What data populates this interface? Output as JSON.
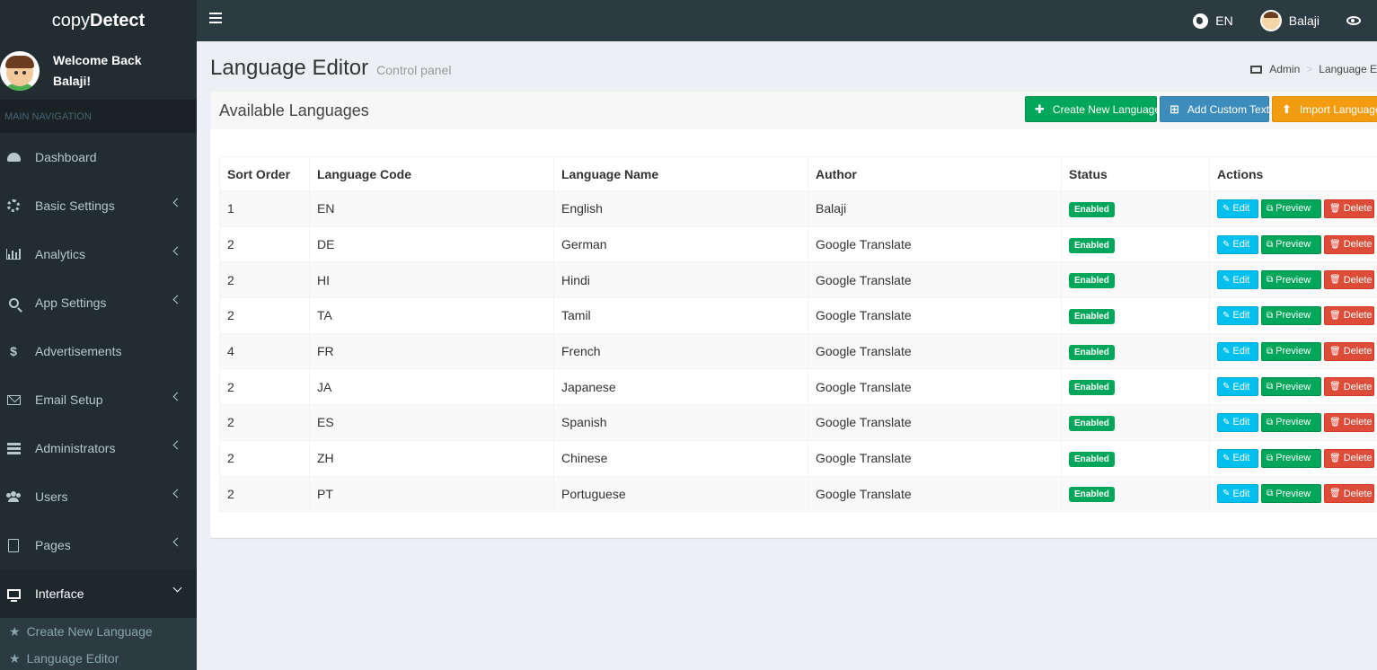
{
  "brand": {
    "light": "copy",
    "bold": "Detect"
  },
  "topbar": {
    "language": "EN",
    "username": "Balaji"
  },
  "user_panel": {
    "line1": "Welcome Back",
    "line2": "Balaji!"
  },
  "sidebar": {
    "header": "MAIN NAVIGATION",
    "items": [
      {
        "label": "Dashboard",
        "icon": "dashboard-icon"
      },
      {
        "label": "Basic Settings",
        "icon": "cogs-icon"
      },
      {
        "label": "Analytics",
        "icon": "bar-chart-icon"
      },
      {
        "label": "App Settings",
        "icon": "search-icon"
      },
      {
        "label": "Advertisements",
        "icon": "dollar-icon"
      },
      {
        "label": "Email Setup",
        "icon": "envelope-icon"
      },
      {
        "label": "Administrators",
        "icon": "list-icon"
      },
      {
        "label": "Users",
        "icon": "users-icon"
      },
      {
        "label": "Pages",
        "icon": "file-icon"
      },
      {
        "label": "Interface",
        "icon": "desktop-icon"
      }
    ],
    "subitems": [
      {
        "label": "Create New Language"
      },
      {
        "label": "Language Editor"
      }
    ]
  },
  "header": {
    "title": "Language Editor",
    "subtitle": "Control panel"
  },
  "breadcrumb": {
    "root": "Admin",
    "current": "Language E"
  },
  "box": {
    "title": "Available Languages",
    "buttons": {
      "create": "Create New Language",
      "custom": "Add Custom Text",
      "import": "Import Language"
    }
  },
  "table": {
    "headers": [
      "Sort Order",
      "Language Code",
      "Language Name",
      "Author",
      "Status",
      "Actions"
    ],
    "rows": [
      {
        "order": "1",
        "code": "EN",
        "name": "English",
        "author": "Balaji",
        "status": "Enabled"
      },
      {
        "order": "2",
        "code": "DE",
        "name": "German",
        "author": "Google Translate",
        "status": "Enabled"
      },
      {
        "order": "2",
        "code": "HI",
        "name": "Hindi",
        "author": "Google Translate",
        "status": "Enabled"
      },
      {
        "order": "2",
        "code": "TA",
        "name": "Tamil",
        "author": "Google Translate",
        "status": "Enabled"
      },
      {
        "order": "4",
        "code": "FR",
        "name": "French",
        "author": "Google Translate",
        "status": "Enabled"
      },
      {
        "order": "2",
        "code": "JA",
        "name": "Japanese",
        "author": "Google Translate",
        "status": "Enabled"
      },
      {
        "order": "2",
        "code": "ES",
        "name": "Spanish",
        "author": "Google Translate",
        "status": "Enabled"
      },
      {
        "order": "2",
        "code": "ZH",
        "name": "Chinese",
        "author": "Google Translate",
        "status": "Enabled"
      },
      {
        "order": "2",
        "code": "PT",
        "name": "Portuguese",
        "author": "Google Translate",
        "status": "Enabled"
      }
    ],
    "actions": {
      "edit": "Edit",
      "preview": "Preview",
      "delete": "Delete"
    }
  },
  "colors": {
    "sidebar": "#222d32",
    "topbar": "#2c3b41",
    "success": "#00a65a",
    "info": "#00c0ef",
    "danger": "#dd4b39",
    "primary": "#3c8dbc",
    "warning": "#f39c12"
  }
}
